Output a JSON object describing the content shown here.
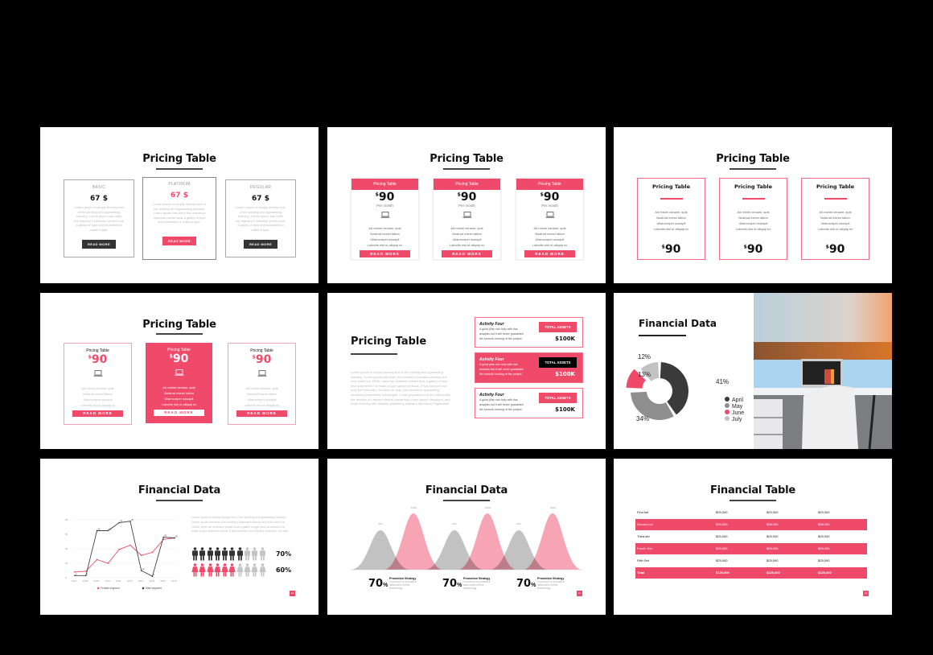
{
  "colors": {
    "accent": "#f04a6a",
    "dark": "#333333",
    "gray": "#999999",
    "background": "#000000"
  },
  "slides": {
    "s1": {
      "title": "Pricing Table",
      "cards": [
        {
          "label": "BASIC",
          "price": "67 $",
          "lorem": "Lorem ipsum is simply dummy text of the printing and typesetting industry. Lorem ipsum has been the industry's unknown printer took a galley of type and scrambled it make a type.",
          "button": "READ MORE"
        },
        {
          "label": "PLATINUM",
          "price": "67 $",
          "lorem": "Lorem ipsum is simply dummy text of the printing and typesetting industry. Lorem ipsum has been the industry's unknown printer took a galley of type and scrambled it make a type.",
          "button": "READ MORE"
        },
        {
          "label": "REGULAR",
          "price": "67 $",
          "lorem": "Lorem ipsum is simply dummy text of the printing and typesetting industry. Lorem ipsum has been the industry's unknown printer took a galley of type and scrambled it make a type.",
          "button": "READ MORE"
        }
      ]
    },
    "s2": {
      "title": "Pricing Table",
      "cards": [
        {
          "header": "Pricing Table",
          "currency": "$",
          "price": "90",
          "period": "Per month",
          "features": [
            "Ad minim veniam, quis",
            "Nostrud exerci tation",
            "Ullamcorper suscipit",
            "Lobortis nisl ut aliquip ex"
          ],
          "button": "READ MORE",
          "icon": "laptop-icon"
        },
        {
          "header": "Pricing Table",
          "currency": "$",
          "price": "90",
          "period": "Per month",
          "features": [
            "Ad minim veniam, quis",
            "Nostrud exerci tation",
            "Ullamcorper suscipit",
            "Lobortis nisl ut aliquip ex"
          ],
          "button": "READ MORE",
          "icon": "laptop-icon"
        },
        {
          "header": "Pricing Table",
          "currency": "$",
          "price": "90",
          "period": "Per month",
          "features": [
            "Ad minim veniam, quis",
            "Nostrud exerci tation",
            "Ullamcorper suscipit",
            "Lobortis nisl ut aliquip ex"
          ],
          "button": "READ MORE",
          "icon": "laptop-icon"
        }
      ]
    },
    "s3": {
      "title": "Pricing Table",
      "cards": [
        {
          "header": "Pricing Table",
          "features": [
            "Ad minim veniam, quis",
            "Nostrud exerci tation",
            "Ullamcorper suscipit",
            "Lobortis nisl ut aliquip ex"
          ],
          "currency": "$",
          "price": "90"
        },
        {
          "header": "Pricing Table",
          "features": [
            "Ad minim veniam, quis",
            "Nostrud exerci tation",
            "Ullamcorper suscipit",
            "Lobortis nisl ut aliquip ex"
          ],
          "currency": "$",
          "price": "90"
        },
        {
          "header": "Pricing Table",
          "features": [
            "Ad minim veniam, quis",
            "Nostrud exerci tation",
            "Ullamcorper suscipit",
            "Lobortis nisl ut aliquip ex"
          ],
          "currency": "$",
          "price": "90"
        }
      ]
    },
    "s4": {
      "title": "Pricing Table",
      "cards": [
        {
          "header": "Pricing Table",
          "currency": "$",
          "price": "90",
          "features": [
            "Ad minim veniam, quis",
            "Nostrud exerci tation",
            "Ullamcorper suscipit",
            "Lobortis nisl ut aliquip ex"
          ],
          "button": "READ MORE"
        },
        {
          "header": "Pricing Table",
          "currency": "$",
          "price": "90",
          "features": [
            "Ad minim veniam, quis",
            "Nostrud exerci tation",
            "Ullamcorper suscipit",
            "Lobortis nisl ut aliquip ex"
          ],
          "button": "READ MORE"
        },
        {
          "header": "Pricing Table",
          "currency": "$",
          "price": "90",
          "features": [
            "Ad minim veniam, quis",
            "Nostrud exerci tation",
            "Ullamcorper suscipit",
            "Lobortis nisl ut aliquip ex"
          ],
          "button": "READ MORE"
        }
      ]
    },
    "s5": {
      "title": "Pricing Table",
      "body": "Lorem ipsum is simply dummy text of the printing and typesetting industry. Lorem ipsum has been the industry's standard dummy text ever since the 1500s, when an unknown printer took a galley of type and scrambled it to make a type specimen book. It has survived not only five centuries, but also the leap into electronic typesetting, remaining essentially unchanged. It was popularised in the 1960s with the release of Letraset sheets containing Lorem Ipsum passages, and more recently with desktop publishing software like Aldus PageMaker including versions of Lorem Ipsum.",
      "activities": [
        {
          "title": "Activity Four",
          "desc": "A good plan can help with risk analysis but it will never guarantee the smooth running of the project.",
          "badge": "TOTAL ASSETS",
          "value": "$100K"
        },
        {
          "title": "Activity Four",
          "desc": "A good plan can help with risk analysis but it will never guarantee the smooth running of the project.",
          "badge": "TOTAL ASSETS",
          "value": "$100K"
        },
        {
          "title": "Activity Four",
          "desc": "A good plan can help with risk analysis but it will never guarantee the smooth running of the project.",
          "badge": "TOTAL ASSETS",
          "value": "$100K"
        }
      ]
    },
    "s6": {
      "title": "Financial Data"
    },
    "s7": {
      "title": "Financial Data",
      "body": "Lorem ipsum is simply dummy text of the printing and typesetting industry. Lorem ipsum has been the industry's standard dummy text ever since the 1500s, when an unknown printer took a galley of type and scrambled it to make a type specimen book. It has survived not only five centuries, but also",
      "pictogram": [
        {
          "label": "70%",
          "filled": 7,
          "total": 10,
          "color": "#333333"
        },
        {
          "label": "60%",
          "filled": 6,
          "total": 10,
          "color": "#f04a6a"
        }
      ],
      "page": "14"
    },
    "s8": {
      "title": "Financial Data",
      "stats": [
        {
          "value": "70",
          "unit": "%",
          "title": "Promotion Strategy",
          "desc": "Conserve by proactive data client metric technology"
        },
        {
          "value": "70",
          "unit": "%",
          "title": "Promotion Strategy",
          "desc": "Conserve by proactive data client metric technology"
        },
        {
          "value": "70",
          "unit": "%",
          "title": "Promotion Strategy",
          "desc": "Conserve by proactive data client metric technology"
        }
      ],
      "page": "15"
    },
    "s9": {
      "title": "Financial Table",
      "rows": [
        [
          "First set",
          "$25,000",
          "$25,000",
          "$25,000"
        ],
        [
          "Second set",
          "$25,000",
          "$25,000",
          "$25,000"
        ],
        [
          "Third set",
          "$25,000",
          "$25,000",
          "$25,000"
        ],
        [
          "Fourth Set",
          "$25,000",
          "$25,000",
          "$25,000"
        ],
        [
          "Fifth Set",
          "$25,000",
          "$25,000",
          "$25,000"
        ],
        [
          "Total",
          "$125,000",
          "$125,000",
          "$125,000"
        ]
      ],
      "page": "16"
    }
  },
  "chart_data": [
    {
      "type": "pie",
      "title": "Financial Data",
      "donut": true,
      "labels": [
        "April",
        "May",
        "June",
        "July"
      ],
      "values": [
        41,
        34,
        13,
        12
      ],
      "data_labels": [
        "41%",
        "34%",
        "13%",
        "12%"
      ],
      "colors": [
        "#3a3a3a",
        "#8e8e8e",
        "#f04a6a",
        "#c2c2c2"
      ],
      "legend": "right"
    },
    {
      "type": "line",
      "title": "",
      "x": [
        "2007",
        "2008",
        "2009",
        "2010",
        "2011",
        "2012",
        "2013",
        "2014",
        "2015",
        "2016"
      ],
      "series": [
        {
          "name": "Female segment",
          "color": "#f04a6a",
          "values": [
            8,
            9,
            25,
            20,
            39,
            45,
            31,
            35,
            53,
            55
          ]
        },
        {
          "name": "Male segment",
          "color": "#444444",
          "values": [
            3,
            3,
            65,
            65,
            76,
            78,
            10,
            2,
            56,
            55
          ]
        }
      ],
      "yticks": [
        "0",
        "20",
        "40",
        "60",
        "80"
      ],
      "ylim": [
        0,
        80
      ],
      "legend": "bottom",
      "grid": true
    },
    {
      "type": "area",
      "title": "",
      "series": [
        {
          "name": "gray",
          "color": "#b3b3b3",
          "peaks": [
            70,
            70,
            70
          ],
          "labels": [
            "70%",
            "70%",
            "70%"
          ]
        },
        {
          "name": "pink",
          "color": "#f58da1",
          "peaks": [
            100,
            100,
            100
          ],
          "labels": [
            "100%",
            "100%",
            "100%"
          ]
        }
      ],
      "ylim": [
        0,
        100
      ]
    }
  ]
}
